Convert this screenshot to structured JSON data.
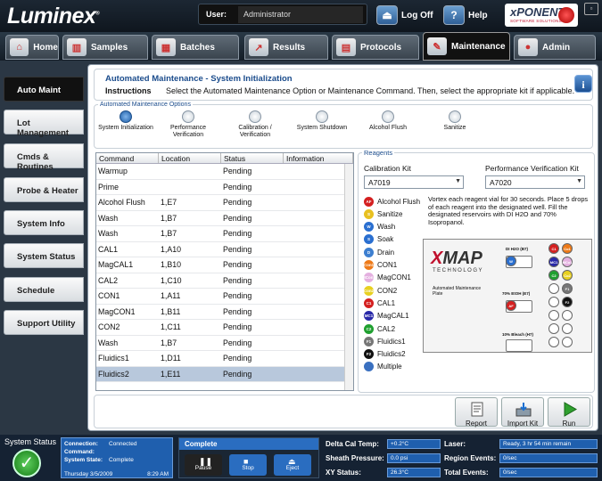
{
  "header": {
    "logo": "Luminex",
    "logo_mark": "®",
    "user_label": "User:",
    "user_value": "Administrator",
    "logoff_label": "Log Off",
    "help_label": "Help",
    "brand_name": "xPONENT",
    "brand_sub": "SOFTWARE SOLUTIONS",
    "window_control": "▫"
  },
  "nav": {
    "tabs": [
      {
        "label": "Home",
        "icon": "home-icon"
      },
      {
        "label": "Samples",
        "icon": "samples-icon"
      },
      {
        "label": "Batches",
        "icon": "batches-icon"
      },
      {
        "label": "Results",
        "icon": "results-icon"
      },
      {
        "label": "Protocols",
        "icon": "protocols-icon"
      },
      {
        "label": "Maintenance",
        "icon": "maintenance-icon"
      },
      {
        "label": "Admin",
        "icon": "admin-icon"
      }
    ],
    "active_tab": "Maintenance"
  },
  "sidebar": {
    "items": [
      "Auto Maint",
      "Lot Management",
      "Cmds & Routines",
      "Probe & Heater",
      "System Info",
      "System Status",
      "Schedule",
      "Support Utility"
    ],
    "active": "Auto Maint"
  },
  "main": {
    "title": "Automated Maintenance - System Initialization",
    "instructions_label": "Instructions",
    "instructions_text": "Select the Automated Maintenance Option or Maintenance Command. Then, select the appropriate kit if applicable.",
    "options_title": "Automated Maintenance Options",
    "options": [
      {
        "label": "System Initialization",
        "selected": true
      },
      {
        "label": "Performance Verification",
        "selected": false
      },
      {
        "label": "Calibration / Verification",
        "selected": false
      },
      {
        "label": "System Shutdown",
        "selected": false
      },
      {
        "label": "Alcohol Flush",
        "selected": false
      },
      {
        "label": "Sanitize",
        "selected": false
      }
    ],
    "table": {
      "columns": [
        "Command",
        "Location",
        "Status",
        "Information"
      ],
      "rows": [
        [
          "Warmup",
          "",
          "Pending",
          ""
        ],
        [
          "Prime",
          "",
          "Pending",
          ""
        ],
        [
          "Alcohol Flush",
          "1,E7",
          "Pending",
          ""
        ],
        [
          "Wash",
          "1,B7",
          "Pending",
          ""
        ],
        [
          "Wash",
          "1,B7",
          "Pending",
          ""
        ],
        [
          "CAL1",
          "1,A10",
          "Pending",
          ""
        ],
        [
          "MagCAL1",
          "1,B10",
          "Pending",
          ""
        ],
        [
          "CAL2",
          "1,C10",
          "Pending",
          ""
        ],
        [
          "CON1",
          "1,A11",
          "Pending",
          ""
        ],
        [
          "MagCON1",
          "1,B11",
          "Pending",
          ""
        ],
        [
          "CON2",
          "1,C11",
          "Pending",
          ""
        ],
        [
          "Wash",
          "1,B7",
          "Pending",
          ""
        ],
        [
          "Fluidics1",
          "1,D11",
          "Pending",
          ""
        ],
        [
          "Fluidics2",
          "1,E11",
          "Pending",
          ""
        ]
      ],
      "selected_row": 13
    },
    "reagents": {
      "title": "Reagents",
      "calibration_kit_label": "Calibration Kit",
      "calibration_kit_value": "A7019",
      "verification_kit_label": "Performance Verification Kit",
      "verification_kit_value": "A7020",
      "legend": [
        {
          "code": "AF",
          "label": "Alcohol Flush",
          "color": "#d42020"
        },
        {
          "code": "S",
          "label": "Sanitize",
          "color": "#e8c020"
        },
        {
          "code": "W",
          "label": "Wash",
          "color": "#2a6fd0"
        },
        {
          "code": "S",
          "label": "Soak",
          "color": "#2a6fd0"
        },
        {
          "code": "D",
          "label": "Drain",
          "color": "#3d7fd0"
        },
        {
          "code": "Con1",
          "label": "CON1",
          "color": "#ee7a18"
        },
        {
          "code": "MCon1",
          "label": "MagCON1",
          "color": "#e4b0e0"
        },
        {
          "code": "Con2",
          "label": "CON2",
          "color": "#e8d020"
        },
        {
          "code": "C1",
          "label": "CAL1",
          "color": "#d42020"
        },
        {
          "code": "MC1",
          "label": "MagCAL1",
          "color": "#2828a8"
        },
        {
          "code": "C2",
          "label": "CAL2",
          "color": "#20a030"
        },
        {
          "code": "F1",
          "label": "Fluidics1",
          "color": "#777777"
        },
        {
          "code": "F2",
          "label": "Fluidics2",
          "color": "#111111"
        },
        {
          "code": "",
          "label": "Multiple",
          "color": "#3a70c0"
        }
      ],
      "note": "Vortex each reagent vial for 30 seconds. Place 5 drops of each reagent into the designated well. Fill the designated reservoirs with DI H2O and 70% Isopropanol.",
      "plate": {
        "logo_x": "X",
        "logo_rest": "MAP",
        "tech": "TECHNOLOGY",
        "caption": "Automated Maintenance Plate",
        "label_h2o": "DI H2O (B7)",
        "label_etoh": "70% EtOH (E7)",
        "label_bleach": "10% Bleach (H7)",
        "well_w": "W",
        "well_af": "AF",
        "wells": [
          "C1",
          "Co1",
          "MC1",
          "MCo1",
          "C2",
          "Co2",
          "F1",
          "F2"
        ]
      }
    },
    "actions": [
      "Report",
      "Import Kit",
      "Run"
    ]
  },
  "statusbar": {
    "title": "System Status",
    "connection_label": "Connection:",
    "connection_value": "Connected",
    "command_label": "Command:",
    "command_value": "",
    "state_label": "System State:",
    "state_value": "Complete",
    "date": "Thursday 3/5/2009",
    "time": "8:29 AM",
    "run_status": "Complete",
    "controls": [
      "Pause",
      "Stop",
      "Eject"
    ],
    "metrics_left": [
      {
        "label": "Delta Cal Temp:",
        "value": "+0.2°C"
      },
      {
        "label": "Sheath Pressure:",
        "value": "0.0 psi"
      },
      {
        "label": "XY Status:",
        "value": "26.3°C"
      }
    ],
    "metrics_right": [
      {
        "label": "Laser:",
        "value": "Ready, 3 hr 54 min remain"
      },
      {
        "label": "Region Events:",
        "value": "0/sec"
      },
      {
        "label": "Total Events:",
        "value": "0/sec"
      }
    ]
  },
  "colors": {
    "accent": "#1b4c8c",
    "status_blue": "#1f5fae",
    "ok_green": "#2fa02f"
  }
}
